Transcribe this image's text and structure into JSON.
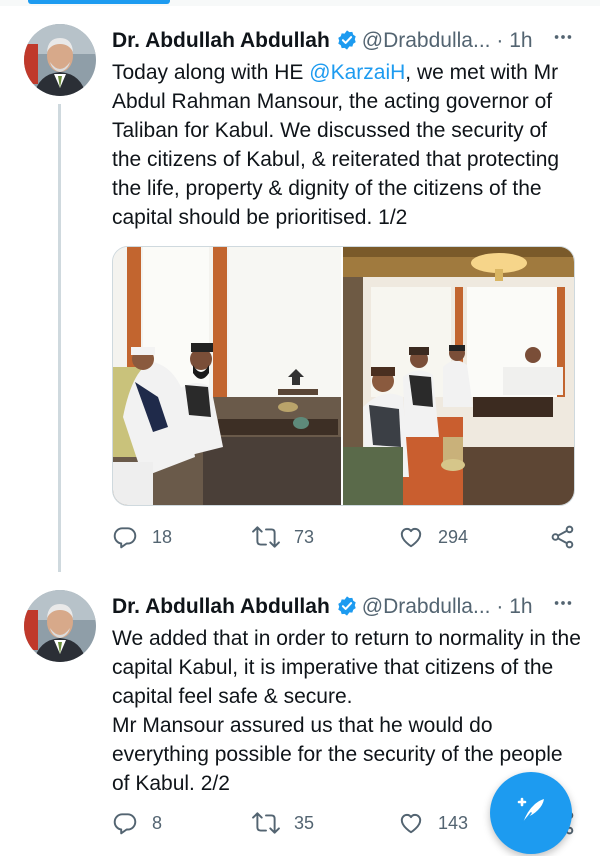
{
  "colors": {
    "accent": "#1d9bf0",
    "text": "#0f1419",
    "muted": "#536471",
    "divider": "#cfd9de"
  },
  "tweets": [
    {
      "author_name": "Dr. Abdullah Abdullah",
      "handle": "@Drabdulla...",
      "separator": "·",
      "time": "1h",
      "more_icon": "more-horizontal-icon",
      "text_before_mention": "Today along with HE ",
      "mention": "@KarzaiH",
      "text_after_mention": ", we met with Mr Abdul Rahman Mansour, the acting governor of Taliban for Kabul. We discussed the security of the citizens of Kabul, & reiterated that protecting the life, property & dignity of the citizens of the capital should be prioritised. 1/2",
      "reply_count": "18",
      "retweet_count": "73",
      "like_count": "294"
    },
    {
      "author_name": "Dr. Abdullah Abdullah",
      "handle": "@Drabdulla...",
      "separator": "·",
      "time": "1h",
      "more_icon": "more-horizontal-icon",
      "text_line1": "We added that in order to return to normality in the capital Kabul, it is imperative that citizens of the capital feel safe & secure.",
      "text_line2": "Mr Mansour assured us that he would do everything possible for the security of the people of Kabul. 2/2",
      "reply_count": "8",
      "retweet_count": "35",
      "like_count": "143"
    }
  ],
  "fab": {
    "icon": "compose-tweet-icon"
  }
}
